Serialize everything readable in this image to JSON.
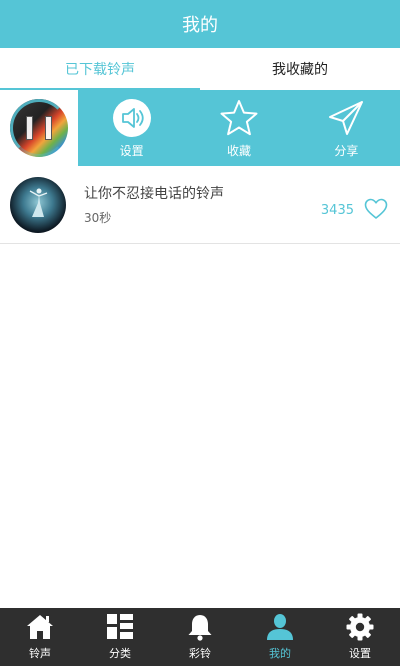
{
  "header": {
    "title": "我的"
  },
  "tabs": [
    {
      "label": "已下载铃声",
      "active": true
    },
    {
      "label": "我收藏的",
      "active": false
    }
  ],
  "player": {
    "state": "playing",
    "actions": [
      {
        "label": "设置",
        "icon": "speaker-icon"
      },
      {
        "label": "收藏",
        "icon": "star-icon"
      },
      {
        "label": "分享",
        "icon": "paper-plane-icon"
      }
    ]
  },
  "songs": [
    {
      "title": "让你不忍接电话的铃声",
      "duration": "30秒",
      "likes": "3435"
    }
  ],
  "bottom_nav": [
    {
      "label": "铃声",
      "icon": "home-icon"
    },
    {
      "label": "分类",
      "icon": "category-icon"
    },
    {
      "label": "彩铃",
      "icon": "bell-icon"
    },
    {
      "label": "我的",
      "icon": "user-icon",
      "active": true
    },
    {
      "label": "设置",
      "icon": "gear-icon"
    }
  ],
  "colors": {
    "accent": "#55c5d6",
    "nav_bg": "#2f2f2f"
  }
}
